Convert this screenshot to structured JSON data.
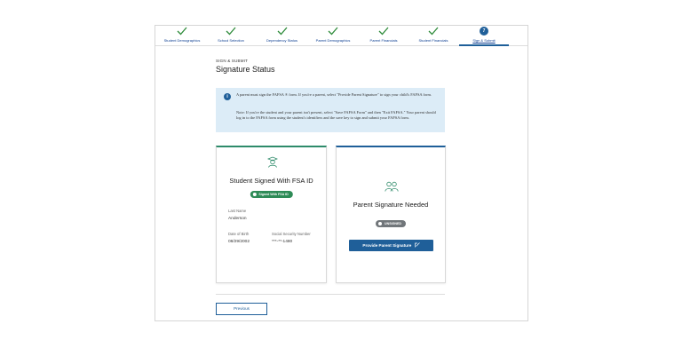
{
  "steps": [
    {
      "label": "Student Demographics",
      "state": "complete"
    },
    {
      "label": "School Selection",
      "state": "complete"
    },
    {
      "label": "Dependency Status",
      "state": "complete"
    },
    {
      "label": "Parent Demographics",
      "state": "complete"
    },
    {
      "label": "Parent Financials",
      "state": "complete"
    },
    {
      "label": "Student Financials",
      "state": "complete"
    },
    {
      "label": "Sign & Submit",
      "state": "active",
      "number": "7"
    }
  ],
  "page": {
    "eyebrow": "SIGN & SUBMIT",
    "title": "Signature Status"
  },
  "alert": {
    "icon": "info-icon",
    "line1": "A parent must sign the FAFSA ® form. If you're a parent, select \"Provide Parent Signature\" to sign your child's FAFSA form.",
    "line2": "Note: If you're the student and your parent isn't present, select \"Save FAFSA Form\" and then \"Exit FAFSA.\" Your parent should log in to the FAFSA form using the student's identifiers and the save key to sign and submit your FAFSA form."
  },
  "student_card": {
    "icon": "student-graduate-icon",
    "title": "Student Signed With FSA ID",
    "badge": "Signed With FSA ID",
    "last_name_label": "Last Name",
    "last_name_value": "Anderson",
    "dob_label": "Date of Birth",
    "dob_value": "08/29/2002",
    "ssn_label": "Social Security Number",
    "ssn_value": "***-**-1480"
  },
  "parent_card": {
    "icon": "parents-group-icon",
    "title": "Parent Signature Needed",
    "badge": "UNSIGNED",
    "button_label": "Provide Parent Signature"
  },
  "footer": {
    "previous_label": "Previous"
  },
  "colors": {
    "primary": "#1f5f99",
    "success": "#2e8b57",
    "check": "#2e8b3a",
    "alert_bg": "#dcecf7",
    "neutral_badge": "#71767a"
  }
}
